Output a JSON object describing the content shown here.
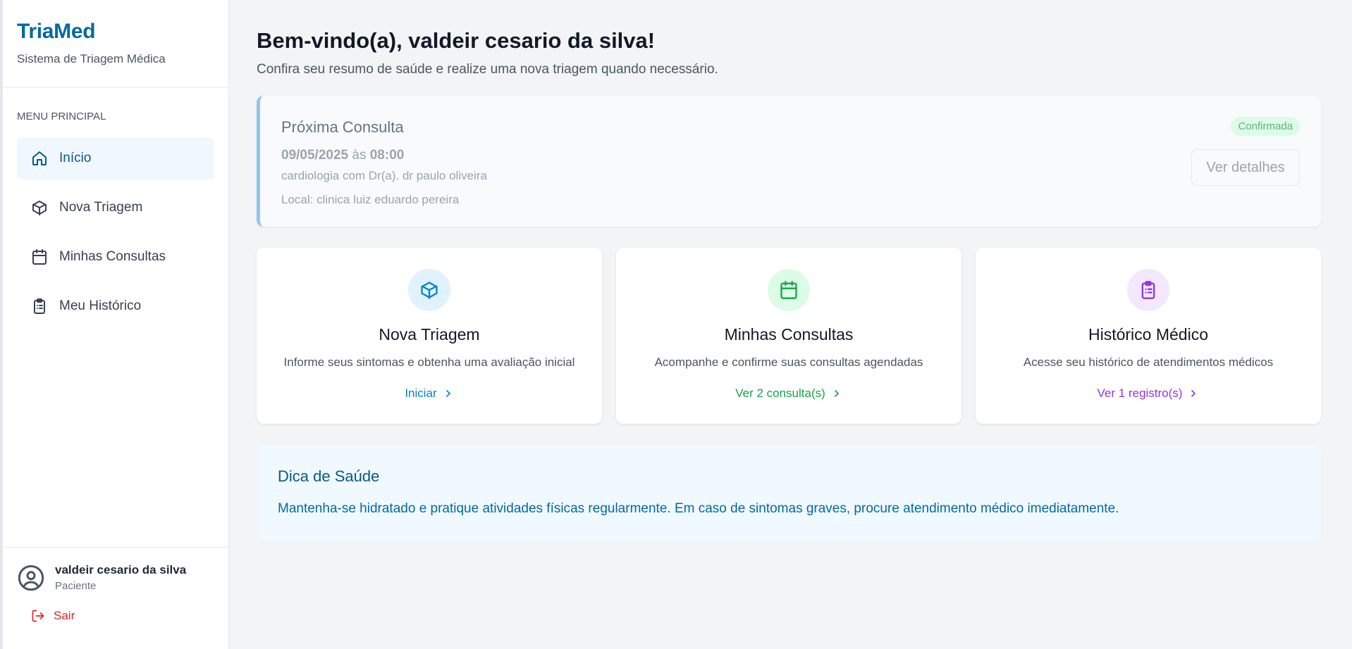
{
  "brand": {
    "title": "TriaMed",
    "subtitle": "Sistema de Triagem Médica"
  },
  "menu": {
    "heading": "MENU PRINCIPAL",
    "items": [
      {
        "label": "Início",
        "icon": "home-icon",
        "active": true
      },
      {
        "label": "Nova Triagem",
        "icon": "cube-icon",
        "active": false
      },
      {
        "label": "Minhas Consultas",
        "icon": "calendar-icon",
        "active": false
      },
      {
        "label": "Meu Histórico",
        "icon": "clipboard-list-icon",
        "active": false
      }
    ]
  },
  "user": {
    "name": "valdeir cesario da silva",
    "role": "Paciente",
    "logout_label": "Sair"
  },
  "header": {
    "title": "Bem-vindo(a), valdeir cesario da silva!",
    "subtitle": "Confira seu resumo de saúde e realize uma nova triagem quando necessário."
  },
  "next_appointment": {
    "title": "Próxima Consulta",
    "date": "09/05/2025",
    "at": "às",
    "time": "08:00",
    "specialty_line": "cardiologia com Dr(a). dr paulo oliveira",
    "location_line": "Local: clinica luiz eduardo pereira",
    "status": "Confirmada",
    "details_label": "Ver detalhes"
  },
  "cards": [
    {
      "title": "Nova Triagem",
      "description": "Informe seus sintomas e obtenha uma avaliação inicial",
      "link": "Iniciar",
      "icon": "cube-icon",
      "accent": "#0284c7",
      "icon_bg": "#e0f2fe"
    },
    {
      "title": "Minhas Consultas",
      "description": "Acompanhe e confirme suas consultas agendadas",
      "link": "Ver 2 consulta(s)",
      "icon": "calendar-icon",
      "accent": "#16a34a",
      "icon_bg": "#dcfce7"
    },
    {
      "title": "Histórico Médico",
      "description": "Acesse seu histórico de atendimentos médicos",
      "link": "Ver 1 registro(s)",
      "icon": "clipboard-list-icon",
      "accent": "#9333ea",
      "icon_bg": "#f3e8ff"
    }
  ],
  "tip": {
    "title": "Dica de Saúde",
    "text": "Mantenha-se hidratado e pratique atividades físicas regularmente. Em caso de sintomas graves, procure atendimento médico imediatamente."
  },
  "colors": {
    "brand": "#0369a1",
    "logout": "#dc2626"
  }
}
